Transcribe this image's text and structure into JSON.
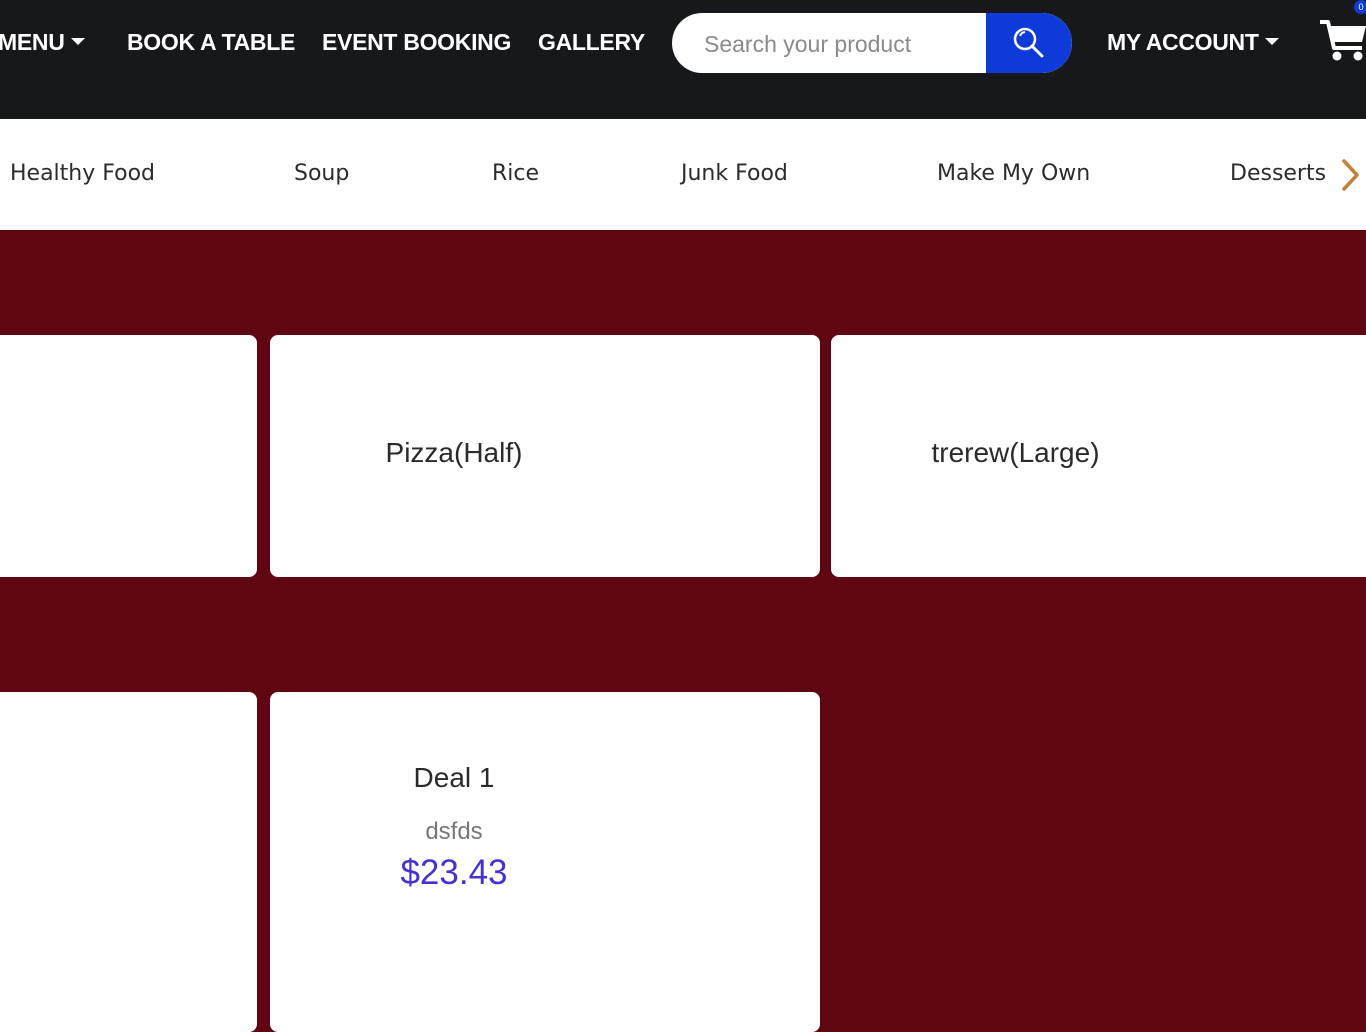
{
  "topnav": {
    "menu_label": "MENU",
    "book_label": "BOOK A TABLE",
    "event_label": "EVENT BOOKING",
    "gallery_label": "GALLERY",
    "search_placeholder": "Search your product",
    "account_label": "MY ACCOUNT",
    "cart_count": "0"
  },
  "categories": [
    "Healthy Food",
    "Soup",
    "Rice",
    "Junk Food",
    "Make My Own",
    "Desserts"
  ],
  "cards": [
    {
      "title": "Pizza(Half)"
    },
    {
      "title": "trerew(Large)"
    },
    {
      "title": "Deal 1",
      "description": "dsfds",
      "price": "$23.43"
    }
  ],
  "colors": {
    "nav_bg": "#17181b",
    "page_bg": "#600512",
    "search_button": "#0d3ad8",
    "price": "#4432d6",
    "chevron": "#c0823a"
  }
}
